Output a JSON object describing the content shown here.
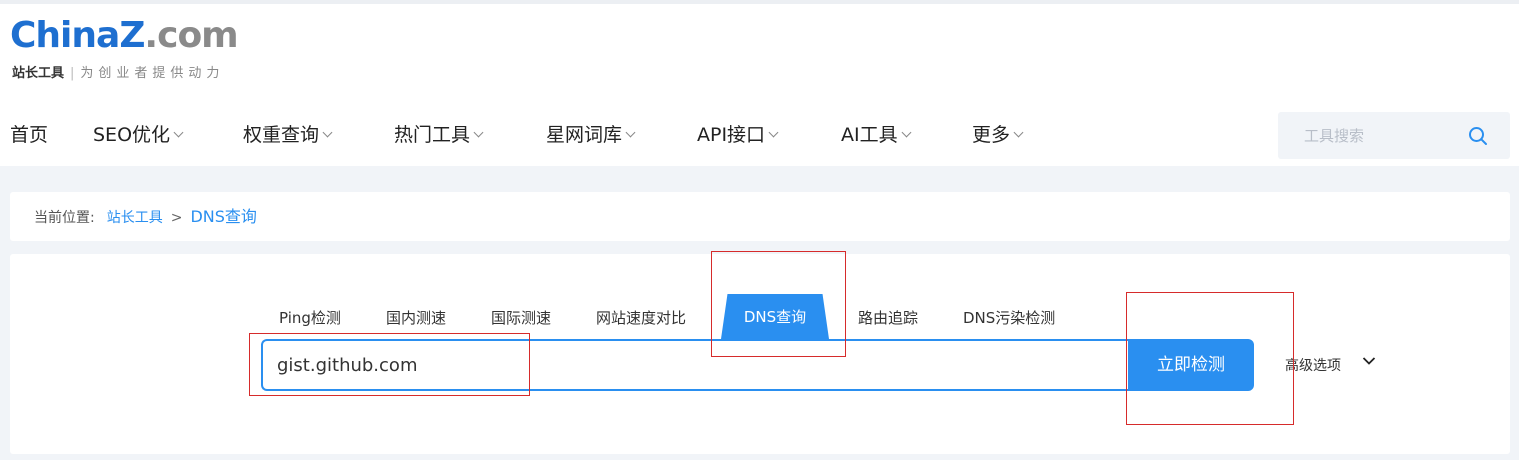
{
  "logo": {
    "brand_main": "China",
    "brand_z": "Z",
    "brand_tld": ".com",
    "tagline_title": "站长工具",
    "tagline_sep": "|",
    "tagline_slogan": "为创业者提供动力"
  },
  "nav": {
    "items": [
      {
        "label": "首页",
        "has_dropdown": false
      },
      {
        "label": "SEO优化",
        "has_dropdown": true
      },
      {
        "label": "权重查询",
        "has_dropdown": true
      },
      {
        "label": "热门工具",
        "has_dropdown": true
      },
      {
        "label": "星网词库",
        "has_dropdown": true
      },
      {
        "label": "API接口",
        "has_dropdown": true
      },
      {
        "label": "AI工具",
        "has_dropdown": true
      },
      {
        "label": "更多",
        "has_dropdown": true
      }
    ],
    "search_placeholder": "工具搜索",
    "search_icon": "search-icon"
  },
  "breadcrumb": {
    "label": "当前位置:",
    "parent": "站长工具",
    "separator": ">",
    "current": "DNS查询"
  },
  "tabs": [
    {
      "label": "Ping检测",
      "active": false
    },
    {
      "label": "国内测速",
      "active": false
    },
    {
      "label": "国际测速",
      "active": false
    },
    {
      "label": "网站速度对比",
      "active": false
    },
    {
      "label": "DNS查询",
      "active": true
    },
    {
      "label": "路由追踪",
      "active": false
    },
    {
      "label": "DNS污染检测",
      "active": false
    }
  ],
  "query": {
    "value": "gist.github.com",
    "submit_label": "立即检测",
    "advanced_label": "高级选项"
  },
  "colors": {
    "accent": "#2a8ff0",
    "logo_blue": "#1e6fd0",
    "annotation": "#d62b2b",
    "page_bg": "#f1f4f8"
  }
}
